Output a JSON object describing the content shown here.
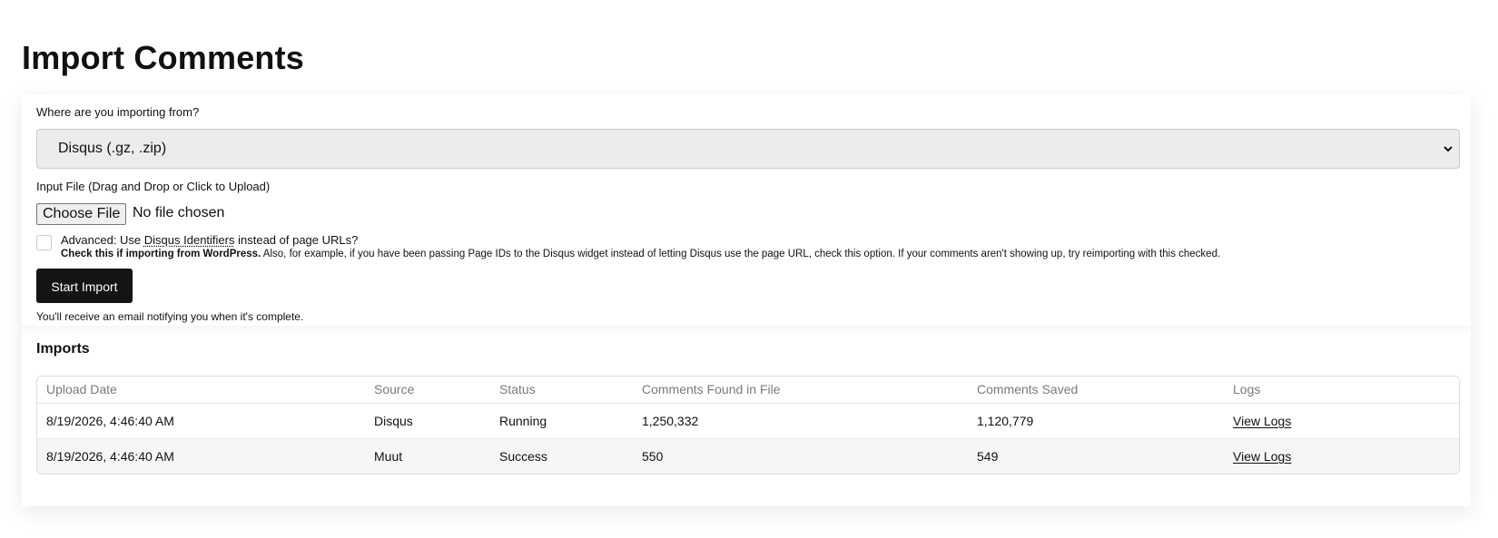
{
  "page": {
    "title": "Import Comments"
  },
  "form": {
    "source_label": "Where are you importing from?",
    "source_selected": "Disqus (.gz, .zip)",
    "file_label": "Input File (Drag and Drop or Click to Upload)",
    "choose_file_label": "Choose File",
    "no_file_text": "No file chosen",
    "advanced": {
      "checked": false,
      "prefix": "Advanced: Use ",
      "link_text": "Disqus Identifiers",
      "suffix": " instead of page URLs?",
      "note_bold": "Check this if importing from WordPress.",
      "note_rest": " Also, for example, if you have been passing Page IDs to the Disqus widget instead of letting Disqus use the page URL, check this option. If your comments aren't showing up, try reimporting with this checked."
    },
    "start_button_label": "Start Import",
    "email_note": "You'll receive an email notifying you when it's complete."
  },
  "imports": {
    "heading": "Imports",
    "columns": [
      "Upload Date",
      "Source",
      "Status",
      "Comments Found in File",
      "Comments Saved",
      "Logs"
    ],
    "rows": [
      {
        "upload_date": "8/19/2026, 4:46:40 AM",
        "source": "Disqus",
        "status": "Running",
        "found": "1,250,332",
        "saved": "1,120,779",
        "logs": "View Logs"
      },
      {
        "upload_date": "8/19/2026, 4:46:40 AM",
        "source": "Muut",
        "status": "Success",
        "found": "550",
        "saved": "549",
        "logs": "View Logs"
      }
    ]
  },
  "icons": {
    "select_arrow": "chevron-down-icon"
  }
}
